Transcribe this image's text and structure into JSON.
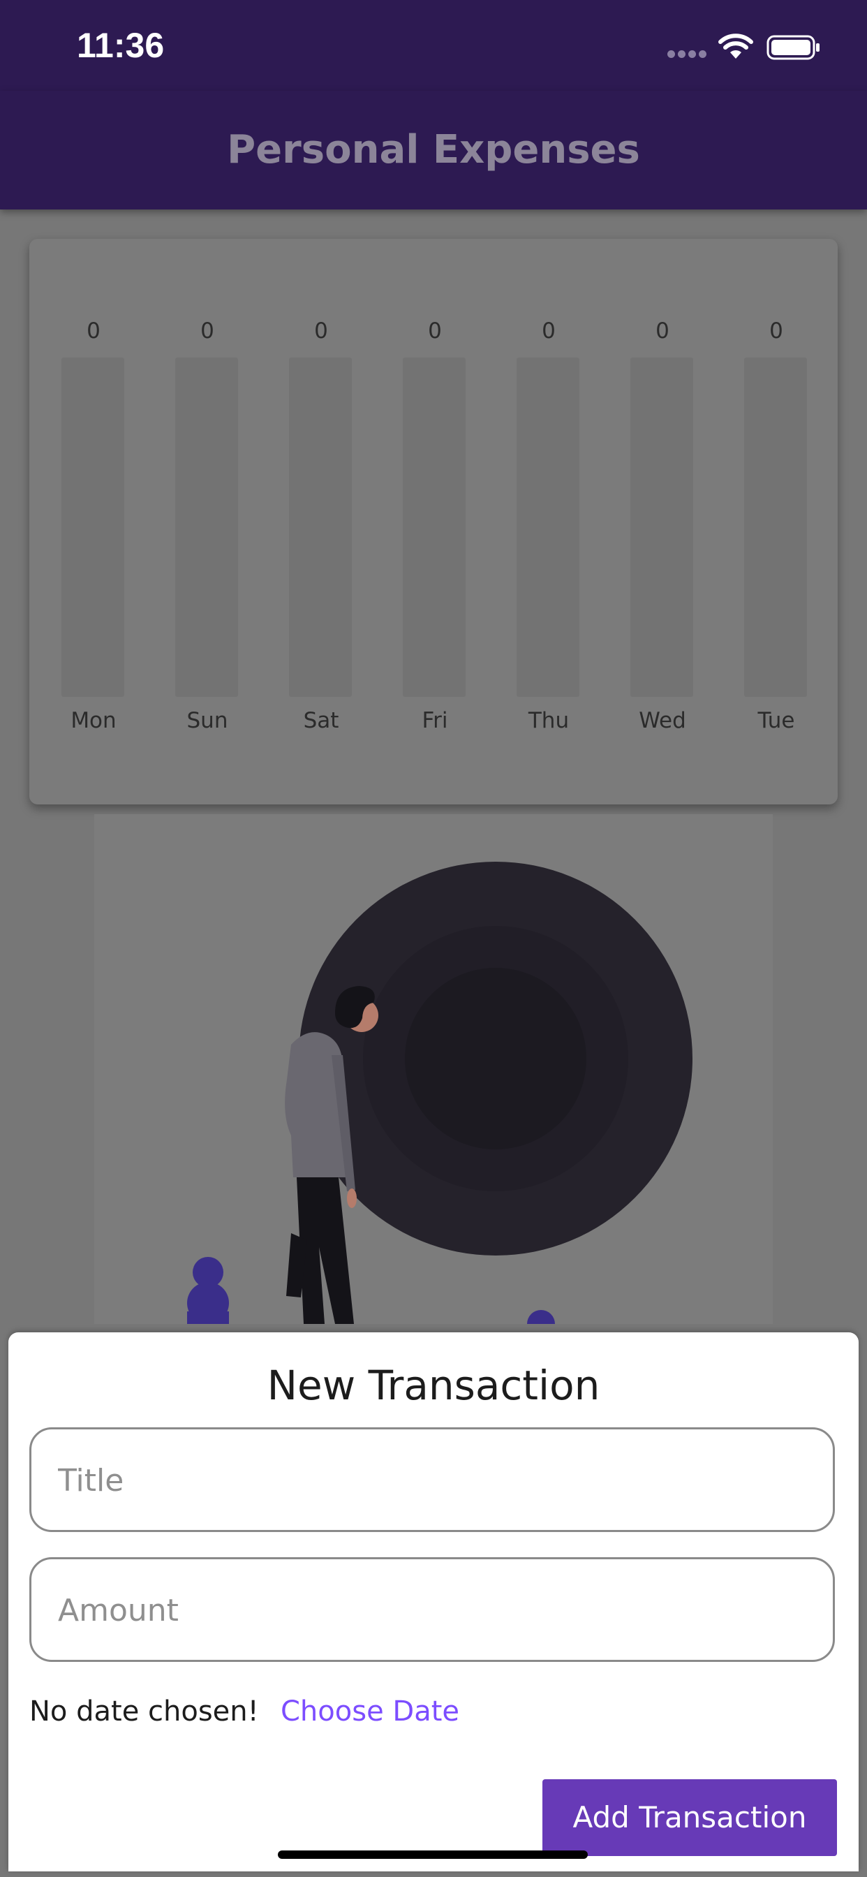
{
  "status_bar": {
    "time": "11:36"
  },
  "app_bar": {
    "title": "Personal Expenses"
  },
  "chart": {
    "days": [
      {
        "day": "Mon",
        "amount": "0",
        "fraction": 0
      },
      {
        "day": "Sun",
        "amount": "0",
        "fraction": 0
      },
      {
        "day": "Sat",
        "amount": "0",
        "fraction": 0
      },
      {
        "day": "Fri",
        "amount": "0",
        "fraction": 0
      },
      {
        "day": "Thu",
        "amount": "0",
        "fraction": 0
      },
      {
        "day": "Wed",
        "amount": "0",
        "fraction": 0
      },
      {
        "day": "Tue",
        "amount": "0",
        "fraction": 0
      }
    ]
  },
  "new_transaction": {
    "title": "New Transaction",
    "title_field": {
      "placeholder": "Title",
      "value": ""
    },
    "amount_field": {
      "placeholder": "Amount",
      "value": ""
    },
    "date_status": "No date chosen!",
    "choose_date_label": "Choose Date",
    "submit_label": "Add Transaction"
  },
  "colors": {
    "app_bar": "#2d1a52",
    "accent": "#7c4dff",
    "primary_button": "#673ab7"
  }
}
